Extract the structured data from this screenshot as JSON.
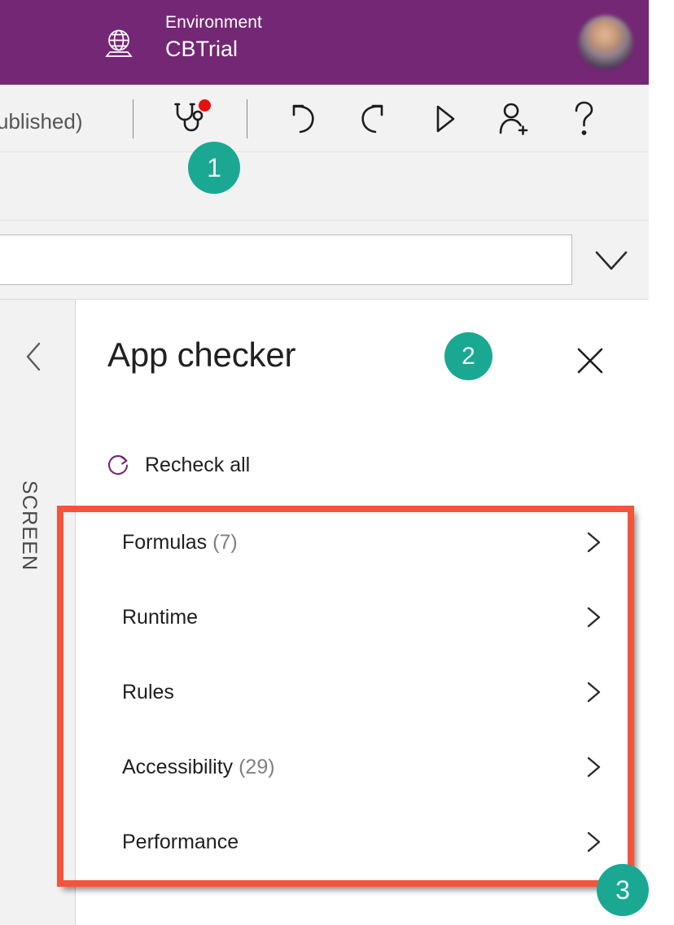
{
  "header": {
    "globe_icon": "globe-icon",
    "environment_label": "Environment",
    "environment_value": "CBTrial",
    "avatar": "user-avatar",
    "background_color": "#742774"
  },
  "toolbar": {
    "left_text": "ublished)",
    "buttons": [
      {
        "name": "app-checker-button",
        "icon": "stethoscope-icon",
        "badge": "red-dot"
      },
      {
        "name": "undo-button",
        "icon": "undo-icon"
      },
      {
        "name": "redo-button",
        "icon": "redo-icon"
      },
      {
        "name": "preview-button",
        "icon": "play-icon"
      },
      {
        "name": "share-button",
        "icon": "person-add-icon"
      },
      {
        "name": "help-button",
        "icon": "question-mark-icon"
      }
    ]
  },
  "formula_bar": {
    "value": "",
    "placeholder": "",
    "expander_icon": "chevron-down-icon"
  },
  "left_rail": {
    "collapse_icon": "chevron-left-icon",
    "label": "SCREEN"
  },
  "panel": {
    "title": "App checker",
    "close_icon": "close-icon",
    "recheck": {
      "icon": "refresh-icon",
      "label": "Recheck all"
    },
    "items": [
      {
        "label": "Formulas",
        "count": "(7)",
        "chevron": "chevron-right-icon"
      },
      {
        "label": "Runtime",
        "count": "",
        "chevron": "chevron-right-icon"
      },
      {
        "label": "Rules",
        "count": "",
        "chevron": "chevron-right-icon"
      },
      {
        "label": "Accessibility",
        "count": "(29)",
        "chevron": "chevron-right-icon"
      },
      {
        "label": "Performance",
        "count": "",
        "chevron": "chevron-right-icon"
      }
    ]
  },
  "annotations": {
    "badge_color": "#1aa893",
    "highlight_color": "#f4543c",
    "badges": [
      {
        "label": "1"
      },
      {
        "label": "2"
      },
      {
        "label": "3"
      }
    ]
  }
}
